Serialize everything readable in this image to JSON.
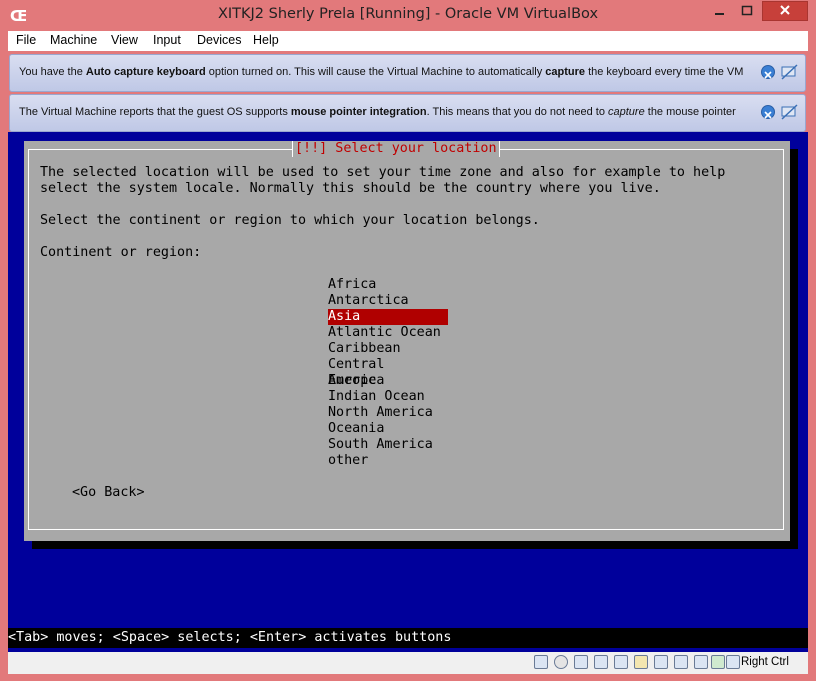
{
  "window": {
    "title": "XITKJ2 Sherly Prela [Running] - Oracle VM VirtualBox"
  },
  "menu": [
    "File",
    "Machine",
    "View",
    "Input",
    "Devices",
    "Help"
  ],
  "notices": [
    {
      "segments": [
        {
          "t": "You have the ",
          "b": false
        },
        {
          "t": "Auto capture keyboard",
          "b": true
        },
        {
          "t": " option turned on. This will cause the Virtual Machine to automatically ",
          "b": false
        },
        {
          "t": "capture",
          "b": true
        },
        {
          "t": " the keyboard every time the VM",
          "b": false
        }
      ]
    },
    {
      "segments": [
        {
          "t": "The Virtual Machine reports that the guest OS supports ",
          "b": false
        },
        {
          "t": "mouse pointer integration",
          "b": true
        },
        {
          "t": ". This means that you do not need to ",
          "b": false
        },
        {
          "t": "capture",
          "b": false,
          "i": true
        },
        {
          "t": " the mouse pointer",
          "b": false
        }
      ]
    }
  ],
  "installer": {
    "dialog_title": "[!!] Select your location",
    "line1": "The selected location will be used to set your time zone and also for example to help",
    "line2": "select the system locale. Normally this should be the country where you live.",
    "line3": "Select the continent or region to which your location belongs.",
    "prompt": "Continent or region:",
    "options": [
      "Africa",
      "Antarctica",
      "Asia",
      "Atlantic Ocean",
      "Caribbean",
      "Central America",
      "Europe",
      "Indian Ocean",
      "North America",
      "Oceania",
      "South America",
      "other"
    ],
    "selected": "Asia",
    "go_back": "<Go Back>",
    "help": "<Tab> moves; <Space> selects; <Enter> activates buttons"
  },
  "statusbar": {
    "host_key": "Right Ctrl",
    "icons": [
      "hard-disk-icon",
      "optical-disk-icon",
      "audio-icon",
      "network-icon",
      "usb-icon",
      "shared-folder-icon",
      "display-icon",
      "video-capture-icon",
      "virtualization-icon",
      "mouse-integration-icon",
      "keyboard-capture-icon"
    ]
  },
  "colors": {
    "titlebar": "#e2797b",
    "vm_background": "#00009b",
    "dialog": "#a8a8a8",
    "selection": "#b00000",
    "dialog_title": "#c00000"
  }
}
